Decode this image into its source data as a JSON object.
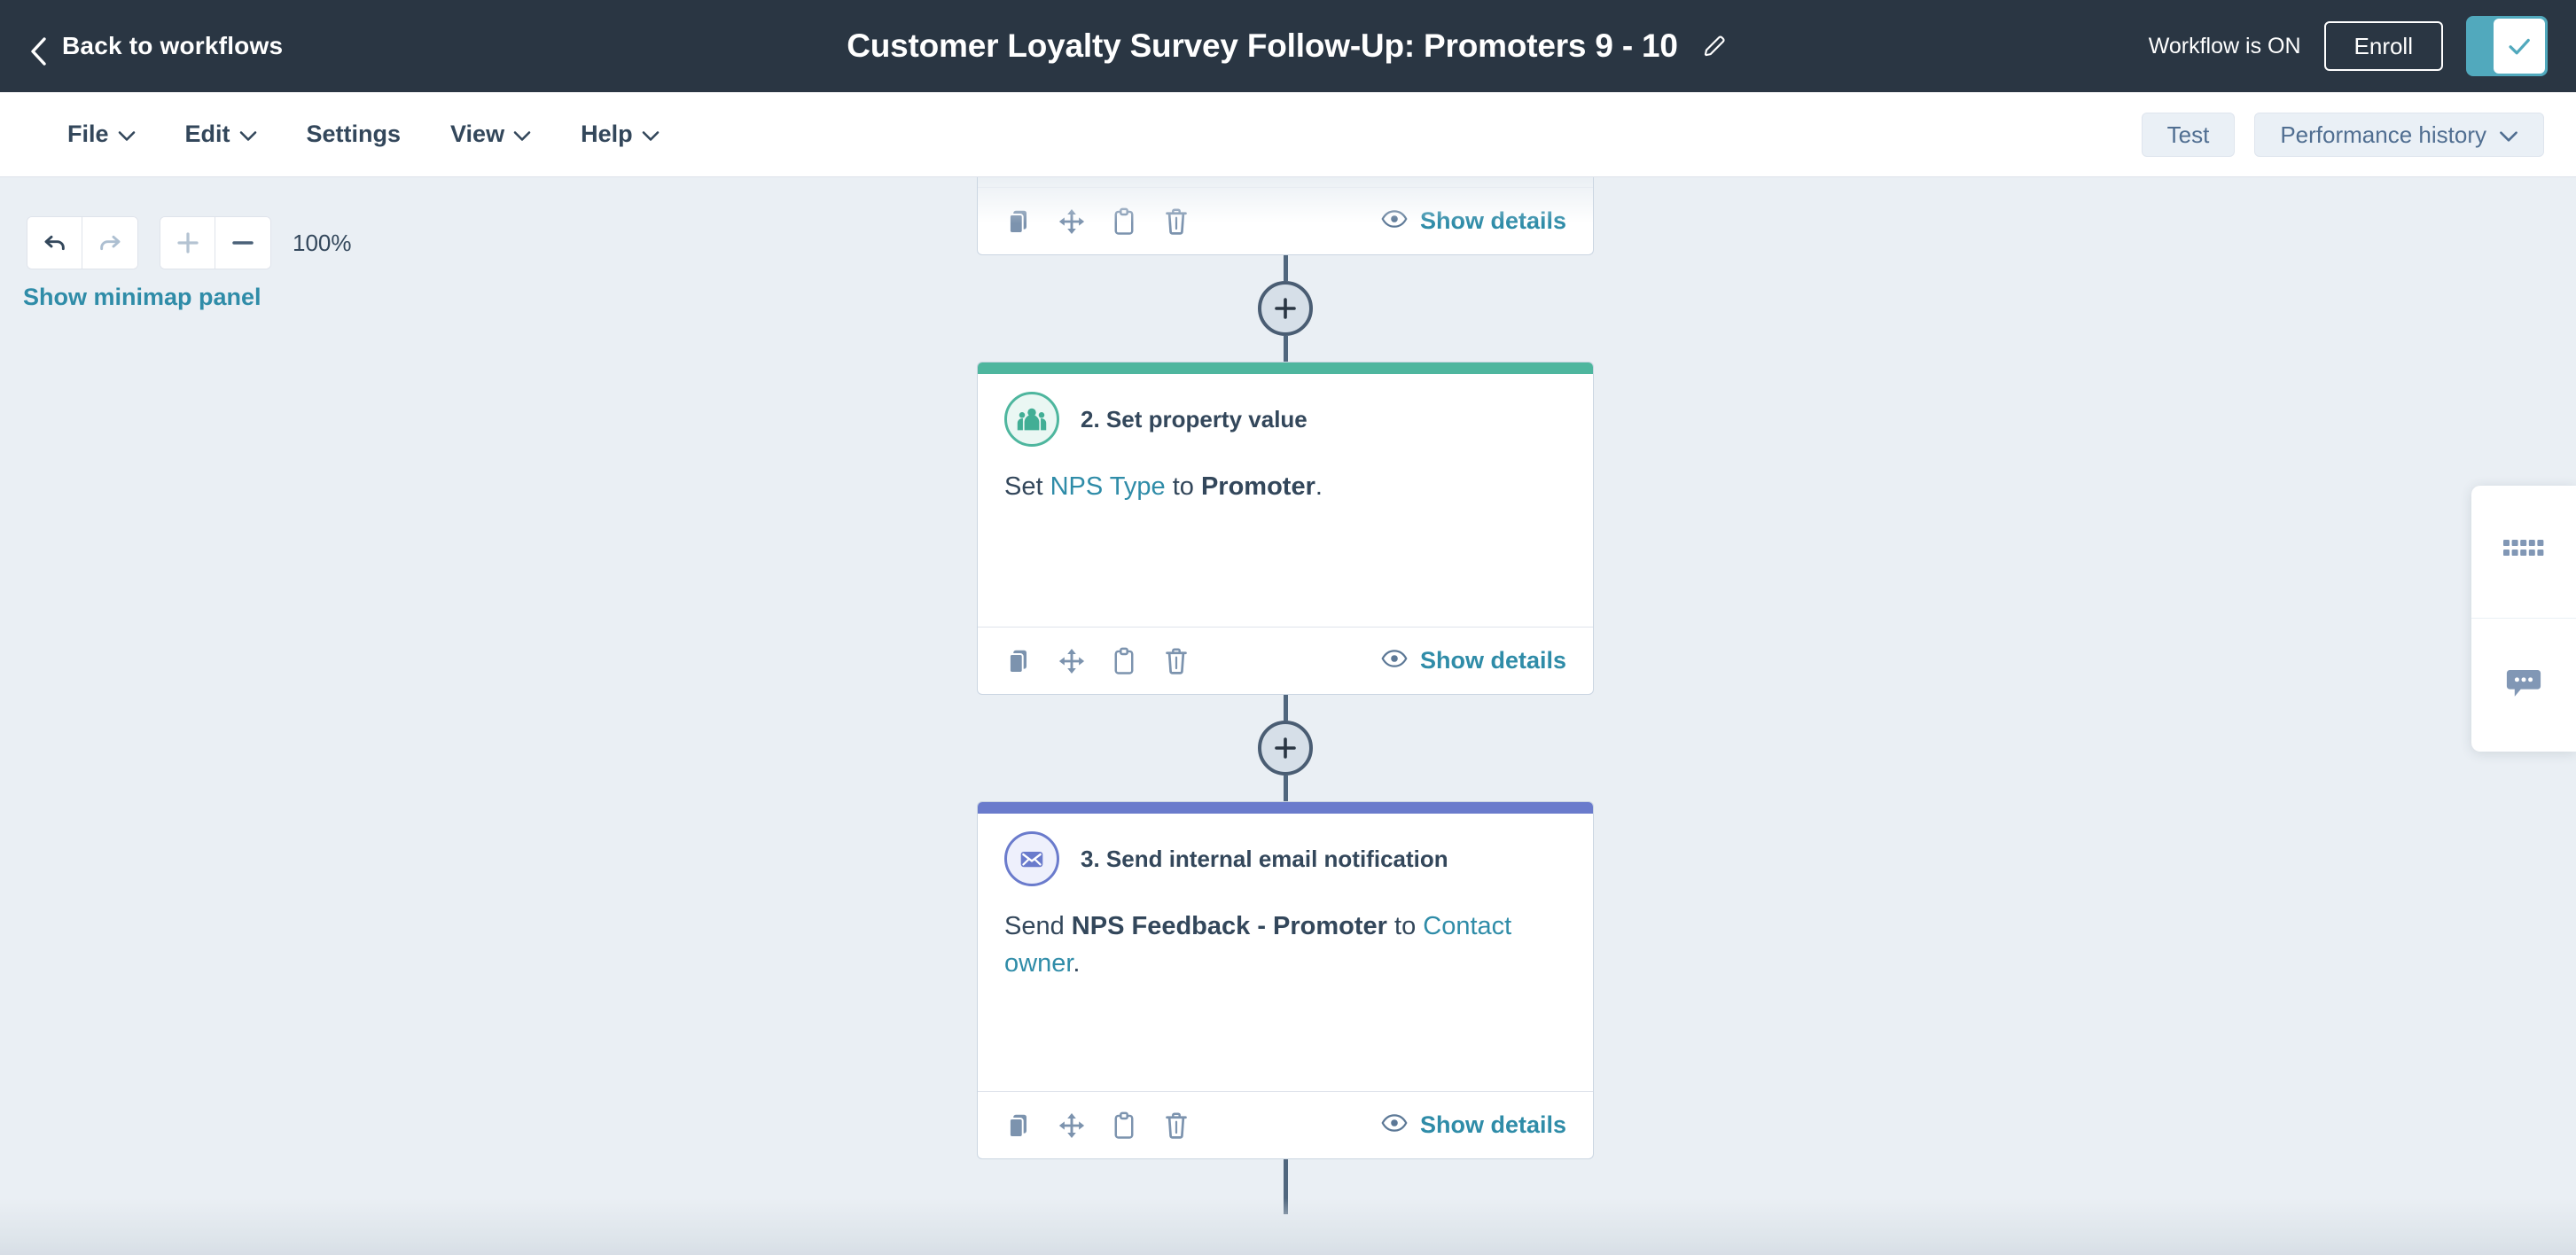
{
  "header": {
    "back_label": "Back to workflows",
    "back_icon": "chevron-left-icon",
    "title": "Customer Loyalty Survey Follow-Up: Promoters 9 - 10",
    "edit_icon": "pencil-icon",
    "workflow_status": "Workflow is ON",
    "enroll_label": "Enroll",
    "toggle_on": true,
    "toggle_icon": "check-icon",
    "bg_color": "#2a3643",
    "toggle_color": "#51a9bd"
  },
  "menubar": {
    "items": [
      {
        "label": "File",
        "has_chevron": true
      },
      {
        "label": "Edit",
        "has_chevron": true
      },
      {
        "label": "Settings",
        "has_chevron": false
      },
      {
        "label": "View",
        "has_chevron": true
      },
      {
        "label": "Help",
        "has_chevron": true
      }
    ],
    "test_label": "Test",
    "performance_label": "Performance history",
    "performance_has_chevron": true
  },
  "canvas": {
    "undo_icon": "undo-arrow-icon",
    "redo_icon": "redo-arrow-icon",
    "zoom_in_icon": "plus-icon",
    "zoom_out_icon": "minus-icon",
    "zoom_level": "100%",
    "minimap_label": "Show minimap panel",
    "link_color": "#2f8ca8",
    "background": "#eaeff4"
  },
  "footer_actions": {
    "copy_icon": "duplicate-icon",
    "move_icon": "move-arrows-icon",
    "clipboard_icon": "clipboard-icon",
    "delete_icon": "trash-icon",
    "details_icon": "eye-icon",
    "details_label": "Show details"
  },
  "flow": {
    "add_step_icon": "plus-icon",
    "cards": [
      {
        "id": "card-partial-top",
        "partial": true,
        "accent": "#51b99f",
        "icon": "",
        "title": "",
        "body_segments": []
      },
      {
        "id": "card-set-property-value",
        "partial": false,
        "accent": "#4eb69e",
        "icon": "contacts-people-icon",
        "icon_ring": "#4eb69e",
        "icon_bg": "#e5f5f1",
        "title": "2. Set property value",
        "body_segments": [
          {
            "text": "Set ",
            "style": "plain"
          },
          {
            "text": "NPS Type",
            "style": "link"
          },
          {
            "text": " to ",
            "style": "plain"
          },
          {
            "text": "Promoter",
            "style": "bold"
          },
          {
            "text": ".",
            "style": "plain"
          }
        ]
      },
      {
        "id": "card-send-internal-email",
        "partial": false,
        "accent": "#6a7bcc",
        "icon": "envelope-icon",
        "icon_ring": "#6a7bcc",
        "icon_bg": "#edeffb",
        "title": "3. Send internal email notification",
        "body_segments": [
          {
            "text": "Send ",
            "style": "plain"
          },
          {
            "text": "NPS Feedback - Promoter",
            "style": "bold"
          },
          {
            "text": " to ",
            "style": "plain"
          },
          {
            "text": "Contact owner",
            "style": "link"
          },
          {
            "text": ".",
            "style": "plain"
          }
        ]
      }
    ]
  },
  "side_panel": {
    "items": [
      {
        "icon": "grid-dots-icon",
        "name": "apps-grid"
      },
      {
        "icon": "chat-bubble-icon",
        "name": "chat"
      }
    ]
  }
}
